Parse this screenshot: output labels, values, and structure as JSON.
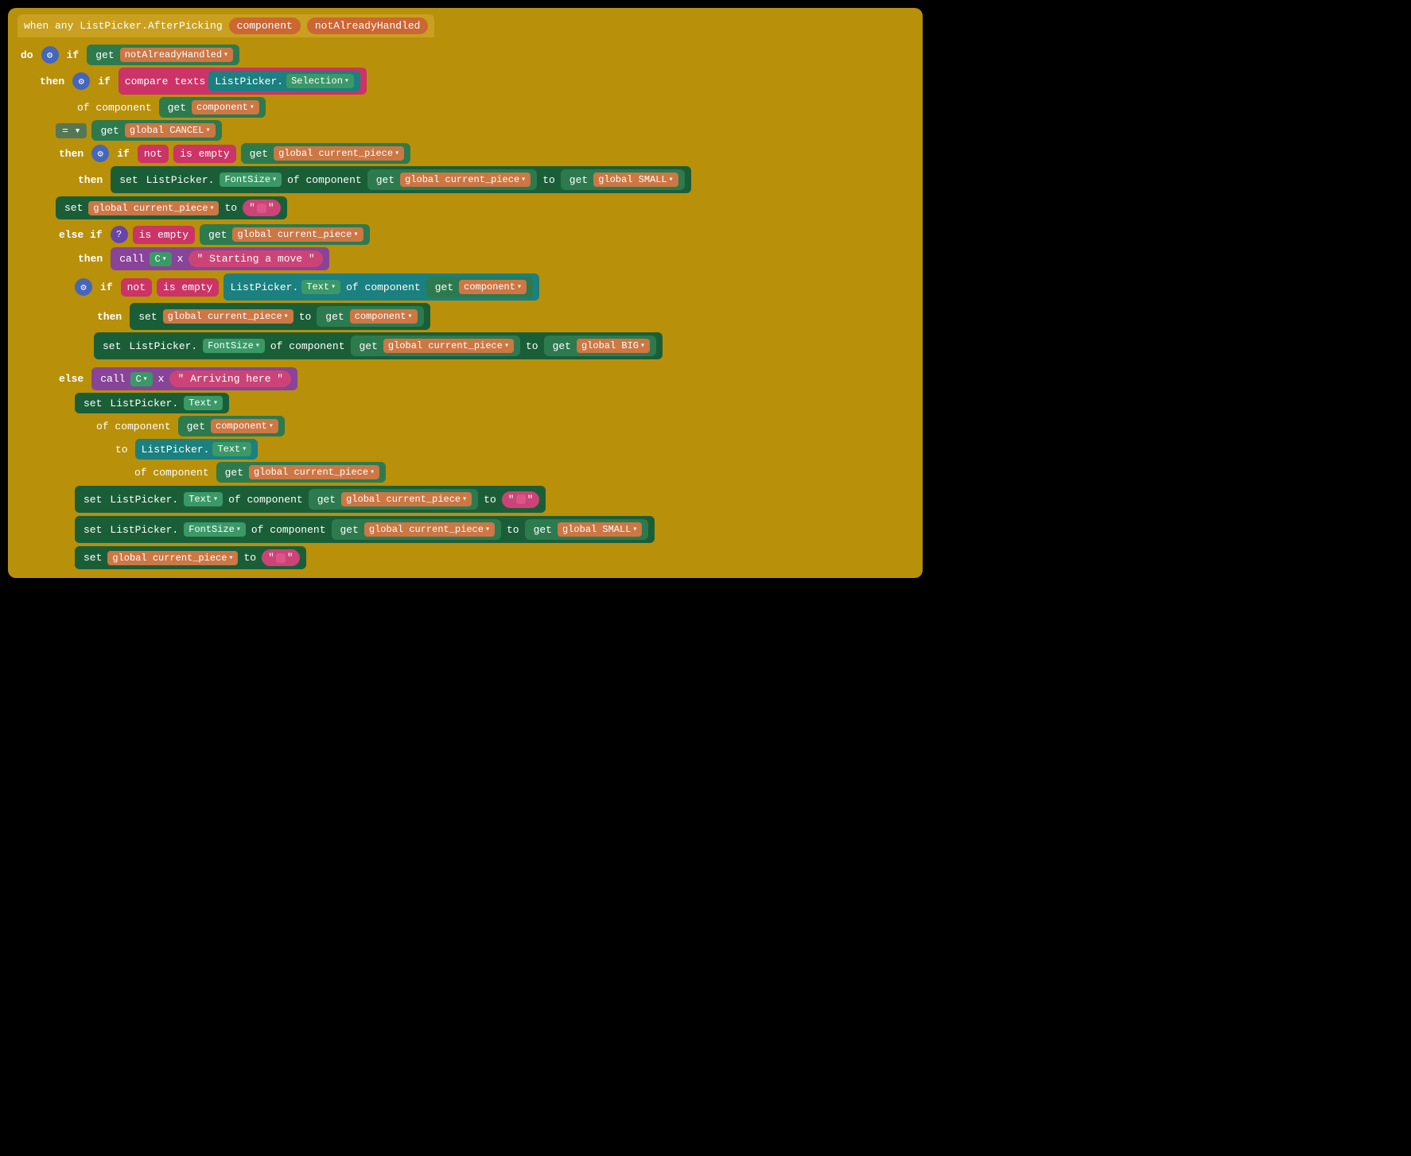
{
  "header": {
    "event": "when any ListPicker.AfterPicking",
    "param1": "component",
    "param2": "notAlreadyHandled"
  },
  "do_label": "do",
  "then_label": "then",
  "else_label": "else",
  "else_if_label": "else if",
  "if_label": "if",
  "not_label": "not",
  "get_label": "get",
  "set_label": "set",
  "call_label": "call",
  "to_label": "to",
  "of_component_label": "of component",
  "compare_texts_label": "compare texts",
  "is_empty_label": "is empty",
  "listpicker_label": "ListPicker.",
  "selection_label": "Selection",
  "fontsize_label": "FontSize",
  "text_label": "Text",
  "component_var": "component",
  "not_already_handled_var": "notAlreadyHandled",
  "global_cancel": "global CANCEL",
  "global_current_piece": "global current_piece",
  "global_small": "global SMALL",
  "global_big": "global BIG",
  "starting_move_str": "\" Starting a move \"",
  "arriving_here_str": "\" Arriving here \"",
  "c_label": "C",
  "x_label": "x",
  "eq_label": "= ▾"
}
